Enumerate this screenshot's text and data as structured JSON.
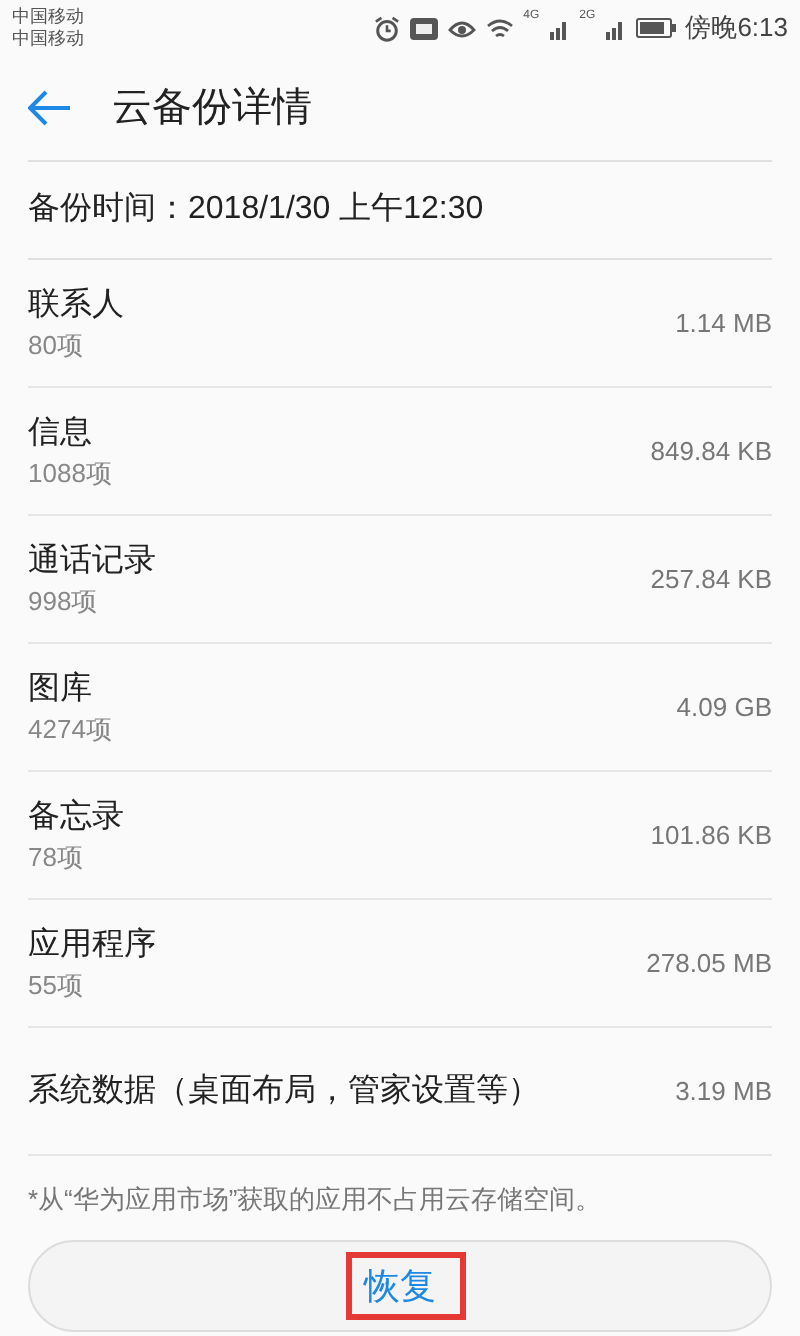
{
  "status_bar": {
    "carriers": [
      "中国移动",
      "中国移动"
    ],
    "network_1": "4G",
    "network_2": "2G",
    "time": "傍晚6:13"
  },
  "header": {
    "title": "云备份详情"
  },
  "backup_time": "备份时间：2018/1/30 上午12:30",
  "items": [
    {
      "name": "联系人",
      "count": "80项",
      "size": "1.14 MB"
    },
    {
      "name": "信息",
      "count": "1088项",
      "size": "849.84 KB"
    },
    {
      "name": "通话记录",
      "count": "998项",
      "size": "257.84 KB"
    },
    {
      "name": "图库",
      "count": "4274项",
      "size": "4.09 GB"
    },
    {
      "name": "备忘录",
      "count": "78项",
      "size": "101.86 KB"
    },
    {
      "name": "应用程序",
      "count": "55项",
      "size": "278.05 MB"
    },
    {
      "name": "系统数据（桌面布局，管家设置等）",
      "size": "3.19 MB"
    }
  ],
  "footnote": "*从“华为应用市场”获取的应用不占用云存储空间。",
  "restore_button": {
    "label": "恢复",
    "highlighted": true
  }
}
